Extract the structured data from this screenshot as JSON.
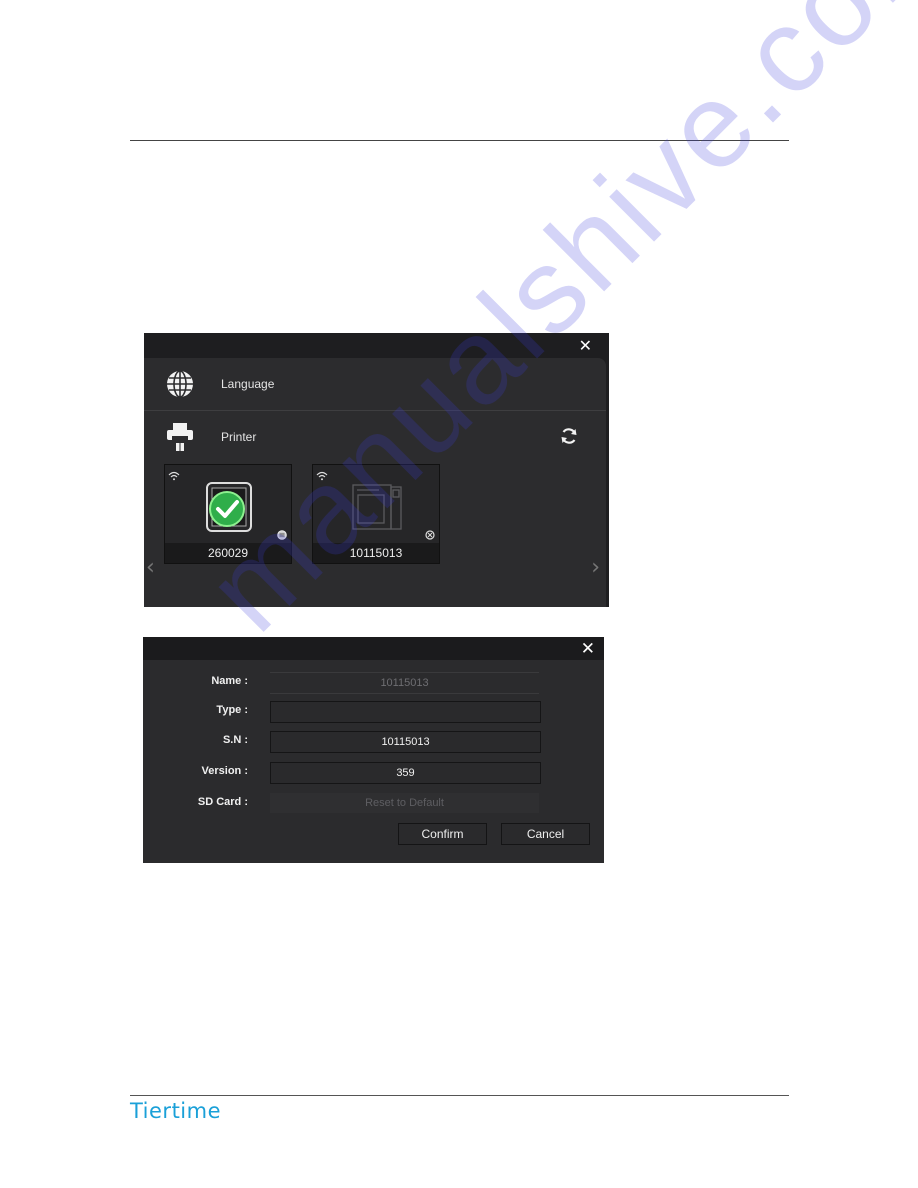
{
  "page": {
    "brand": "Tiertime",
    "watermark": "manualshive.com"
  },
  "printer_dialog": {
    "close_icon": "close-icon",
    "rows": [
      {
        "icon": "globe-icon",
        "label": "Language"
      },
      {
        "icon": "printer-icon",
        "label": "Printer"
      }
    ],
    "refresh_icon": "refresh-icon",
    "printers": [
      {
        "name": "260029",
        "connection": "wifi",
        "selected": true,
        "status_icon": "ready-status-icon"
      },
      {
        "name": "10115013",
        "connection": "wifi",
        "selected": false,
        "status_icon": "disconnected-status-icon"
      }
    ],
    "nav": {
      "prev": "‹",
      "next": "›"
    }
  },
  "info_dialog": {
    "close_icon": "close-icon",
    "fields": [
      {
        "label": "Name :",
        "value": "10115013"
      },
      {
        "label": "Type :",
        "value": ""
      },
      {
        "label": "S.N :",
        "value": "10115013"
      },
      {
        "label": "Version :",
        "value": "359"
      },
      {
        "label": "SD Card :",
        "value": "Reset to Default"
      }
    ],
    "buttons": {
      "confirm": "Confirm",
      "cancel": "Cancel"
    }
  }
}
